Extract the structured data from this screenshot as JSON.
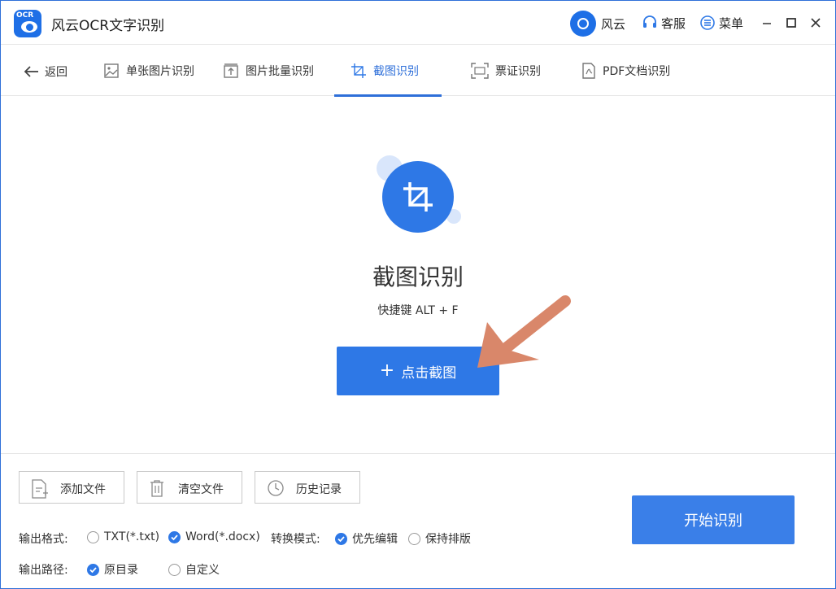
{
  "app": {
    "logo_text": "OCR",
    "title": "风云OCR文字识别",
    "user_name": "风云",
    "service_label": "客服",
    "menu_label": "菜单"
  },
  "nav": {
    "back_label": "返回",
    "tabs": [
      {
        "label": "单张图片识别",
        "icon": "image-icon"
      },
      {
        "label": "图片批量识别",
        "icon": "upload-icon"
      },
      {
        "label": "截图识别",
        "icon": "crop-icon",
        "active": true
      },
      {
        "label": "票证识别",
        "icon": "scan-icon"
      },
      {
        "label": "PDF文档识别",
        "icon": "pdf-icon"
      }
    ]
  },
  "main": {
    "title": "截图识别",
    "shortcut": "快捷键 ALT + F",
    "capture_button": "点击截图"
  },
  "toolbar": {
    "add_file": "添加文件",
    "clear_files": "清空文件",
    "history": "历史记录",
    "start": "开始识别"
  },
  "options": {
    "format_label": "输出格式:",
    "format_txt": "TXT(*.txt)",
    "format_word": "Word(*.docx)",
    "format_selected": "Word(*.docx)",
    "mode_label": "转换模式:",
    "mode_edit": "优先编辑",
    "mode_layout": "保持排版",
    "mode_selected": "优先编辑",
    "path_label": "输出路径:",
    "path_original": "原目录",
    "path_custom": "自定义",
    "path_selected": "原目录"
  },
  "colors": {
    "accent": "#2e78e6",
    "arrow": "#d9876a"
  }
}
